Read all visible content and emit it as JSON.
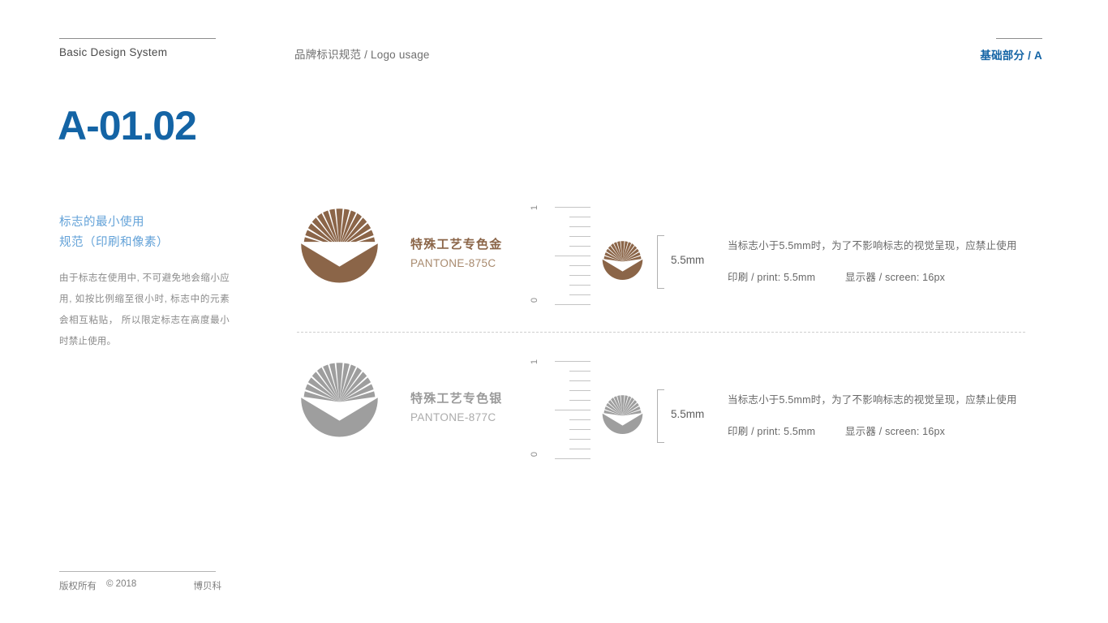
{
  "header": {
    "left_title": "Basic Design System",
    "center_title": "品牌标识规范 / Logo usage",
    "right_title": "基础部分 / A"
  },
  "sidebar": {
    "page_code": "A-01.02",
    "heading_line1": "标志的最小使用",
    "heading_line2": "规范（印刷和像素）",
    "body": "由于标志在使用中, 不可避免地会缩小应用, 如按比例缩至很小时, 标志中的元素会相互粘贴， 所以限定标志在高度最小时禁止使用。"
  },
  "footer": {
    "rights": "版权所有",
    "copyright": "© 2018",
    "brand": "博贝科"
  },
  "sections": [
    {
      "id": "gold",
      "name_cn": "特殊工艺专色金",
      "pantone": "PANTONE-875C",
      "color": "#8B6548",
      "ruler_top_label": "1",
      "ruler_bottom_label": "0",
      "measurement": "5.5mm",
      "desc_line1": "当标志小于5.5mm时，为了不影响标志的视觉呈现，应禁止使用",
      "desc_print": "印刷 / print: 5.5mm",
      "desc_screen": "显示器 / screen: 16px"
    },
    {
      "id": "silver",
      "name_cn": "特殊工艺专色银",
      "pantone": "PANTONE-877C",
      "color": "#9E9E9E",
      "ruler_top_label": "1",
      "ruler_bottom_label": "0",
      "measurement": "5.5mm",
      "desc_line1": "当标志小于5.5mm时，为了不影响标志的视觉呈现，应禁止使用",
      "desc_print": "印刷 / print: 5.5mm",
      "desc_screen": "显示器 / screen: 16px"
    }
  ],
  "colors": {
    "accent_blue": "#1464A5",
    "light_blue": "#63A2D8",
    "gold": "#8B6548",
    "silver": "#9E9E9E"
  }
}
